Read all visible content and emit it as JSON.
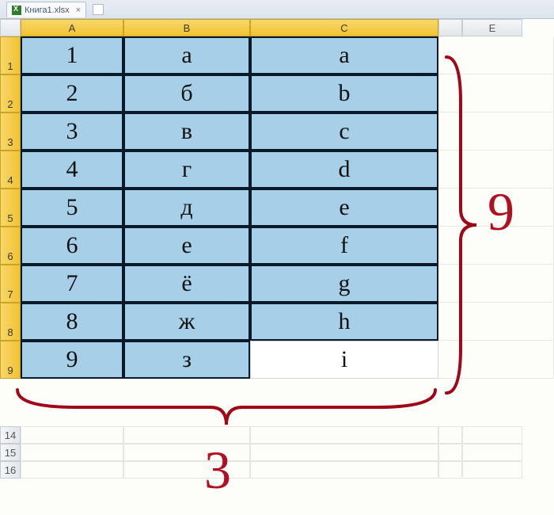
{
  "window": {
    "tab_label": "Книга1.xlsx"
  },
  "columns": [
    "A",
    "B",
    "C",
    "",
    "E"
  ],
  "row_numbers": [
    "1",
    "2",
    "3",
    "4",
    "5",
    "6",
    "7",
    "8",
    "9"
  ],
  "extra_row_numbers": [
    "14",
    "15",
    "16"
  ],
  "cells": {
    "A": [
      "1",
      "2",
      "3",
      "4",
      "5",
      "6",
      "7",
      "8",
      "9"
    ],
    "B": [
      "а",
      "б",
      "в",
      "г",
      "д",
      "е",
      "ё",
      "ж",
      "з"
    ],
    "C": [
      "a",
      "b",
      "c",
      "d",
      "e",
      "f",
      "g",
      "h",
      "i"
    ]
  },
  "unselected": {
    "col": "C",
    "row_index": 8
  },
  "chart_data": {
    "type": "table",
    "columns": [
      "A",
      "B",
      "C"
    ],
    "rows": [
      [
        "1",
        "а",
        "a"
      ],
      [
        "2",
        "б",
        "b"
      ],
      [
        "3",
        "в",
        "c"
      ],
      [
        "4",
        "г",
        "d"
      ],
      [
        "5",
        "д",
        "e"
      ],
      [
        "6",
        "е",
        "f"
      ],
      [
        "7",
        "ё",
        "g"
      ],
      [
        "8",
        "ж",
        "h"
      ],
      [
        "9",
        "з",
        "i"
      ]
    ],
    "annotations": {
      "row_count_label": "9",
      "col_count_label": "3"
    }
  },
  "annotations": {
    "rows_label": "9",
    "cols_label": "3"
  }
}
